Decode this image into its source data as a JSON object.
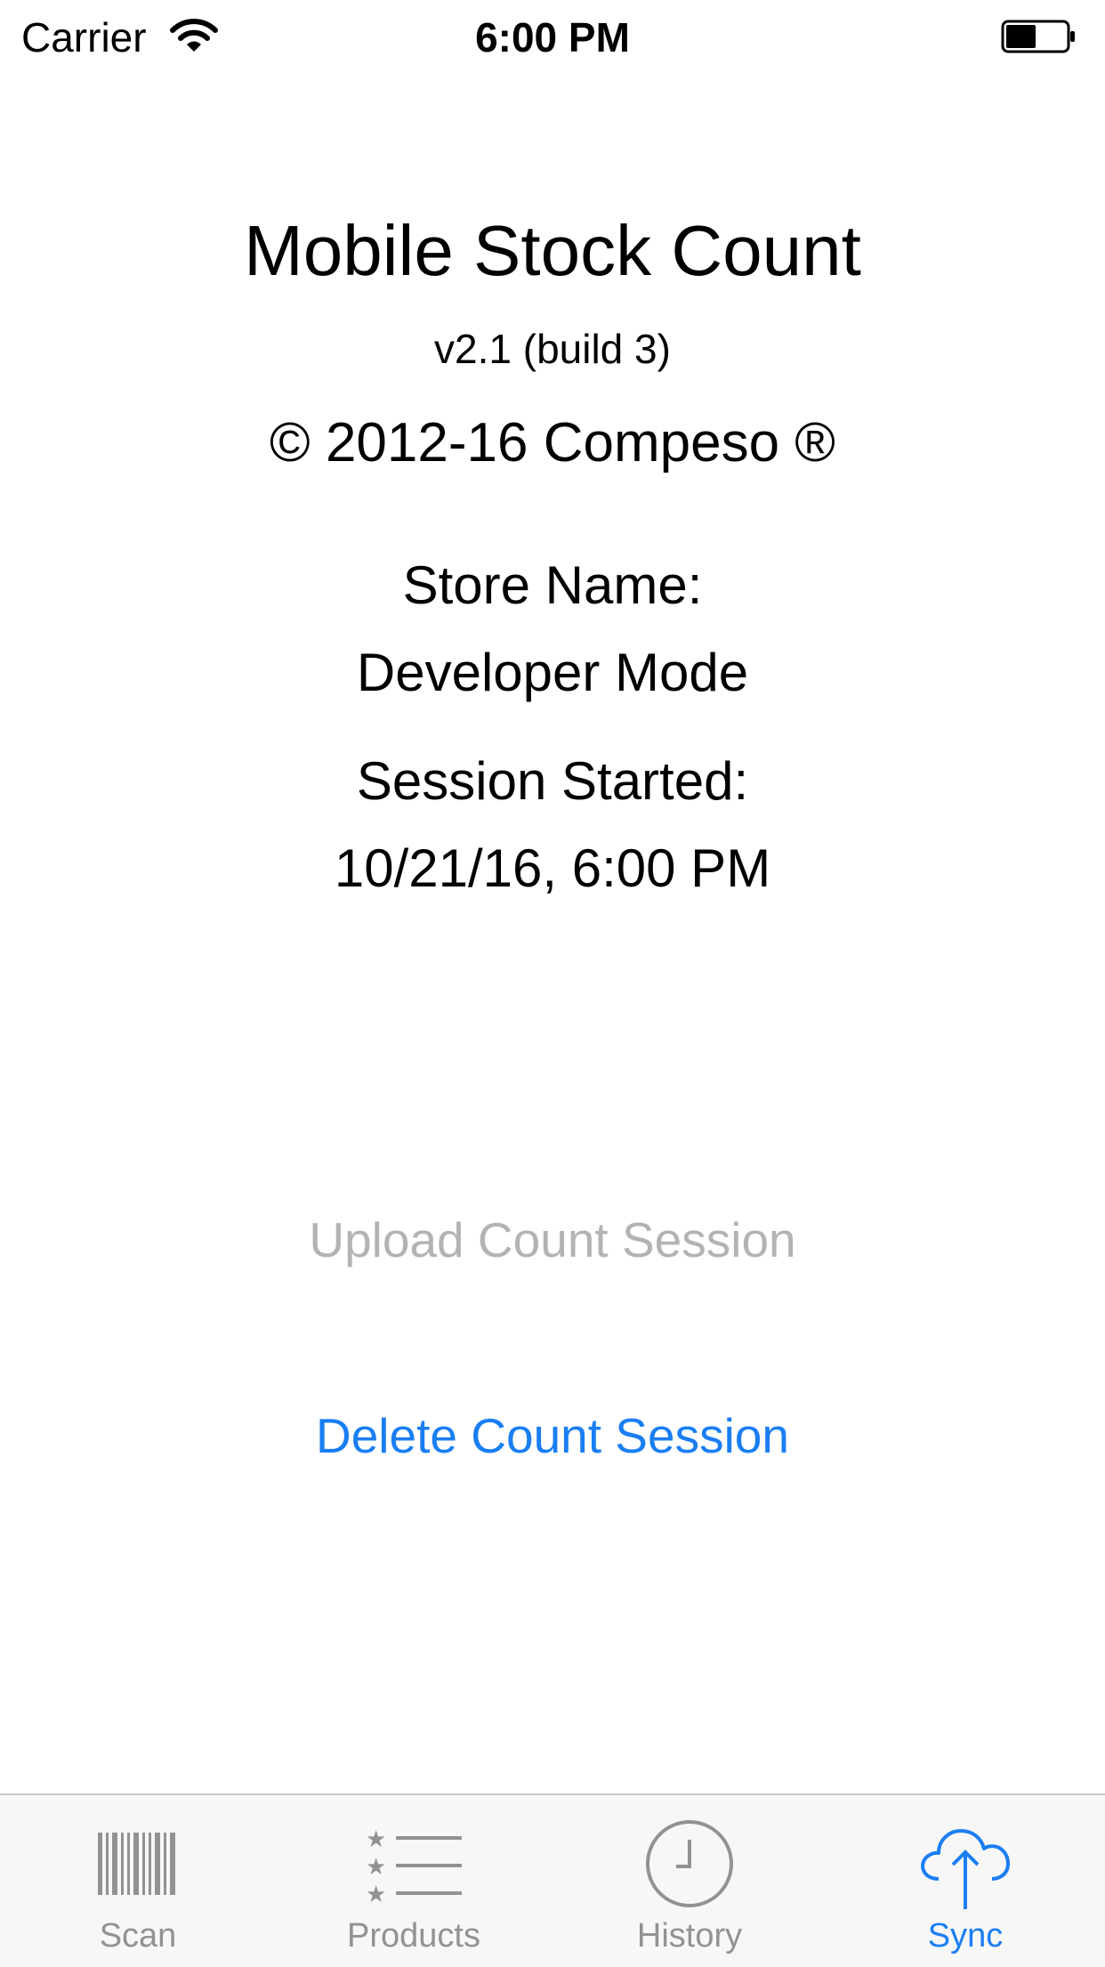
{
  "status_bar": {
    "carrier": "Carrier",
    "time": "6:00 PM",
    "icons": [
      "wifi-icon",
      "battery-icon"
    ]
  },
  "about": {
    "app_title": "Mobile Stock Count",
    "version": "v2.1 (build 3)",
    "copyright": "© 2012-16 Compeso ®"
  },
  "store": {
    "label": "Store Name:",
    "value": "Developer Mode"
  },
  "session": {
    "label": "Session Started:",
    "value": "10/21/16, 6:00 PM"
  },
  "actions": {
    "upload_label": "Upload Count Session",
    "upload_enabled": false,
    "delete_label": "Delete Count Session"
  },
  "tabs": [
    {
      "label": "Scan",
      "icon": "barcode-icon",
      "active": false
    },
    {
      "label": "Products",
      "icon": "star-list-icon",
      "active": false
    },
    {
      "label": "History",
      "icon": "clock-icon",
      "active": false
    },
    {
      "label": "Sync",
      "icon": "cloud-upload-icon",
      "active": true
    }
  ],
  "colors": {
    "accent": "#1a7ef3",
    "disabled_text": "#b3b3b3",
    "inactive_tab": "#929292",
    "tab_bar_bg": "#f7f7f7"
  }
}
